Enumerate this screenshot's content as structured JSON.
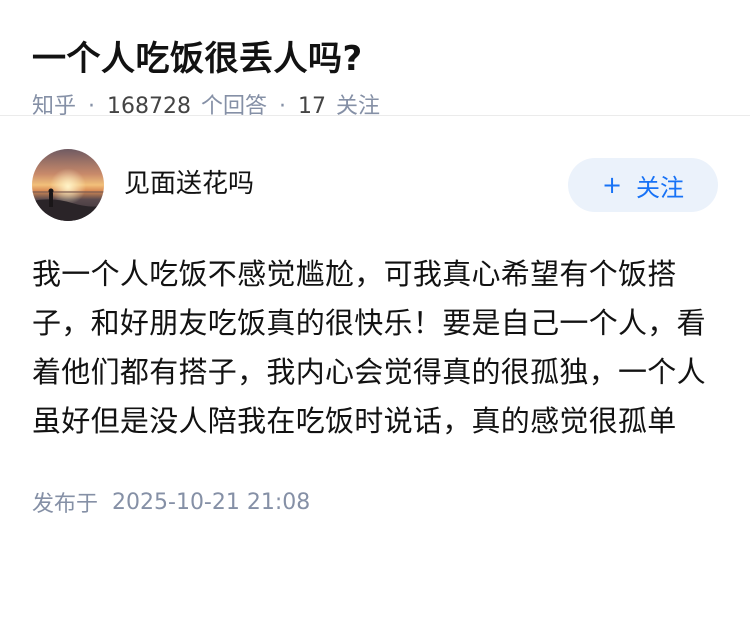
{
  "question": {
    "title": "一个人吃饭很丢人吗?",
    "source": "知乎",
    "answer_count": "168728",
    "answer_label": "个回答",
    "follow_count": "17",
    "follow_label": "关注",
    "separator": "·"
  },
  "answer": {
    "author_name": "见面送花吗",
    "follow_button": {
      "icon": "+",
      "label": "关注"
    },
    "content": "我一个人吃饭不感觉尴尬，可我真心希望有个饭搭子，和好朋友吃饭真的很快乐！要是自己一个人，看着他们都有搭子，我内心会觉得真的很孤独，一个人虽好但是没人陪我在吃饭时说话，真的感觉很孤单",
    "publish_label": "发布于",
    "publish_time": "2025-10-21 21:08"
  },
  "colors": {
    "accent": "#1772f6",
    "follow_bg": "#ebf2fb",
    "meta_gray": "#8590a6",
    "text": "#121212"
  }
}
